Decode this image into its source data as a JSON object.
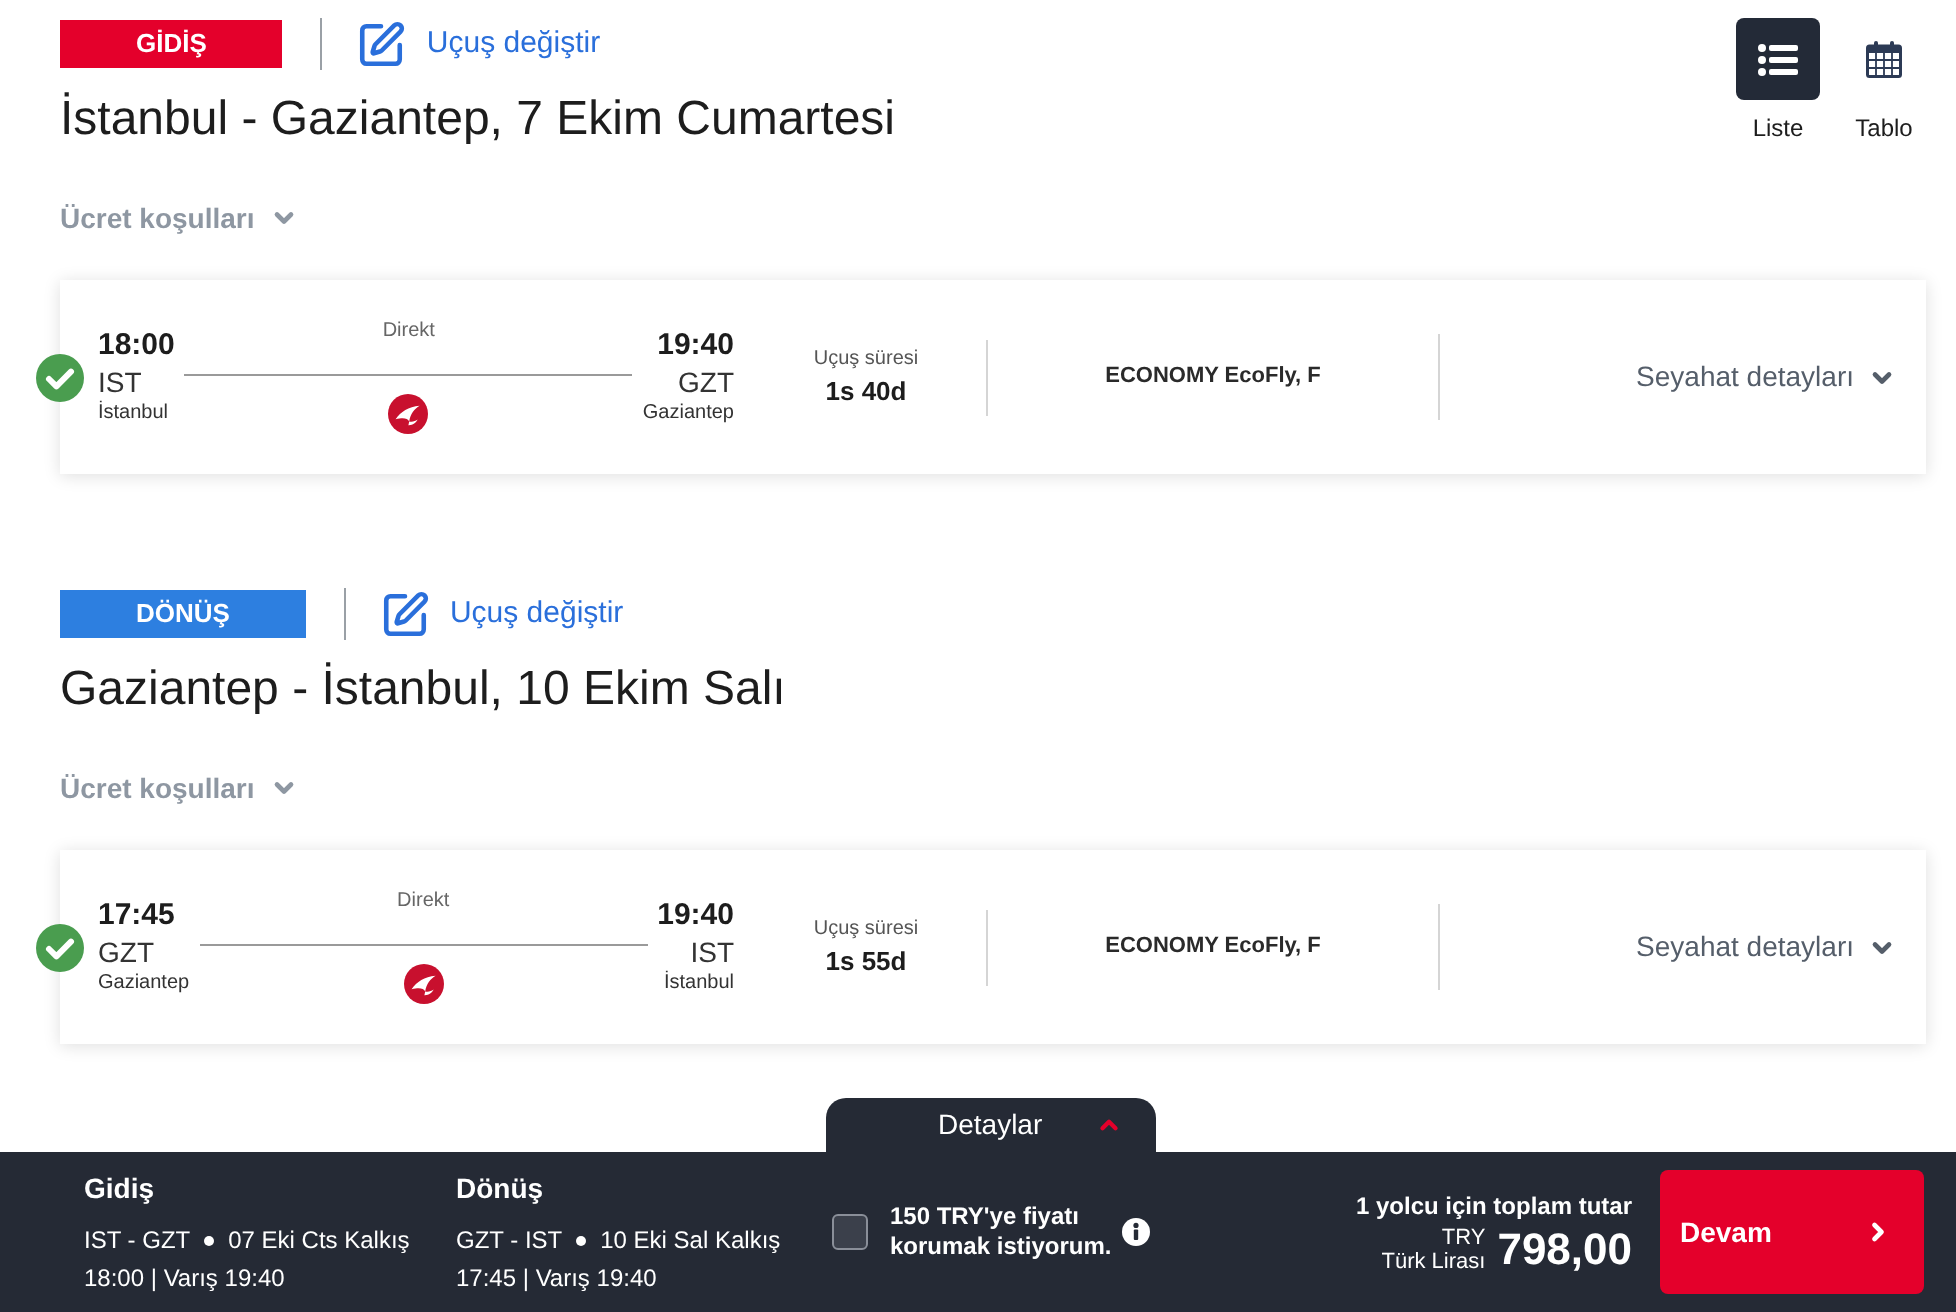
{
  "view_options": [
    {
      "kind": "list",
      "label": "Liste",
      "selected": true
    },
    {
      "kind": "table",
      "label": "Tablo",
      "selected": false
    }
  ],
  "legs": [
    {
      "badge": "GİDİŞ",
      "color": "#e4002b",
      "change_link": "Uçuş değiştir",
      "title": "İstanbul - Gaziantep, 7 Ekim Cumartesi",
      "fare_rules": {
        "label": "Ücret koşulları",
        "expanded": false
      },
      "flight": {
        "selected": true,
        "departure": {
          "time": "18:00",
          "code": "IST",
          "city": "İstanbul"
        },
        "stop": "Direkt",
        "arrival": {
          "time": "19:40",
          "code": "GZT",
          "city": "Gaziantep"
        },
        "duration_label": "Uçuş süresi",
        "duration": "1s 40d",
        "cabin": "ECONOMY EcoFly, F",
        "details": {
          "label": "Seyahat detayları",
          "expanded": false
        }
      }
    },
    {
      "badge": "DÖNÜŞ",
      "color": "#2d7fe0",
      "change_link": "Uçuş değiştir",
      "title": "Gaziantep - İstanbul, 10 Ekim Salı",
      "fare_rules": {
        "label": "Ücret koşulları",
        "expanded": false
      },
      "flight": {
        "selected": true,
        "departure": {
          "time": "17:45",
          "code": "GZT",
          "city": "Gaziantep"
        },
        "stop": "Direkt",
        "arrival": {
          "time": "19:40",
          "code": "IST",
          "city": "İstanbul"
        },
        "duration_label": "Uçuş süresi",
        "duration": "1s 55d",
        "cabin": "ECONOMY EcoFly, F",
        "details": {
          "label": "Seyahat detayları",
          "expanded": false
        }
      }
    }
  ],
  "summary": {
    "tab": "Detaylar",
    "legs": [
      {
        "title": "Gidiş",
        "route": "IST - GZT",
        "date": "07 Eki Cts Kalkış",
        "times": "18:00 | Varış 19:40"
      },
      {
        "title": "Dönüş",
        "route": "GZT - IST",
        "date": "10 Eki Sal Kalkış",
        "times": "17:45 | Varış 19:40"
      }
    ],
    "price_lock": {
      "label": "150 TRY'ye fiyatı korumak istiyorum.",
      "checked": false
    },
    "total_label": "1 yolcu için toplam tutar",
    "currency_code": "TRY",
    "currency_name": "Türk Lirası",
    "amount": "798,00",
    "continue_button": "Devam"
  }
}
